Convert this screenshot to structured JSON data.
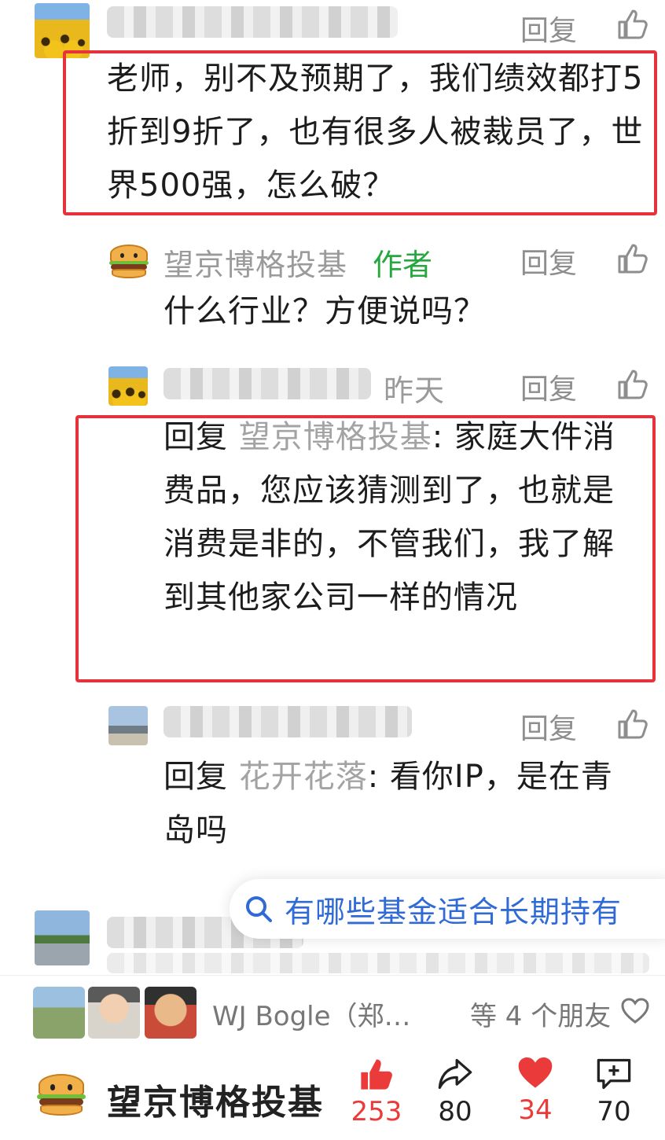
{
  "comments": [
    {
      "reply_label": "回复",
      "text": "老师，别不及预期了，我们绩效都打5折到9折了，也有很多人被裁员了，世界500强，怎么破？"
    },
    {
      "name": "望京博格投基",
      "author_tag": "作者",
      "reply_label": "回复",
      "text": "什么行业？方便说吗？"
    },
    {
      "time": "昨天",
      "reply_label": "回复",
      "quote_prefix": "回复 ",
      "quote_name": "望京博格投基",
      "text": ": 家庭大件消费品，您应该猜测到了，也就是消费是非的，不管我们，我了解到其他家公司一样的情况"
    },
    {
      "reply_label": "回复",
      "quote_prefix": "回复 ",
      "quote_name": "花开花落",
      "text": ": 看你IP，是在青岛吗"
    }
  ],
  "search_suggestion": "有哪些基金适合长期持有",
  "friends": {
    "name": "WJ Bogle（郑…",
    "count_text": "等 4 个朋友"
  },
  "bottom": {
    "author": "望京博格投基",
    "likes": "253",
    "shares": "80",
    "hearts": "34",
    "comments": "70"
  },
  "colors": {
    "highlight_box": "#e6323b",
    "author_green": "#27a83f",
    "link_blue": "#2f6ad6",
    "like_red": "#ea3a3a"
  }
}
